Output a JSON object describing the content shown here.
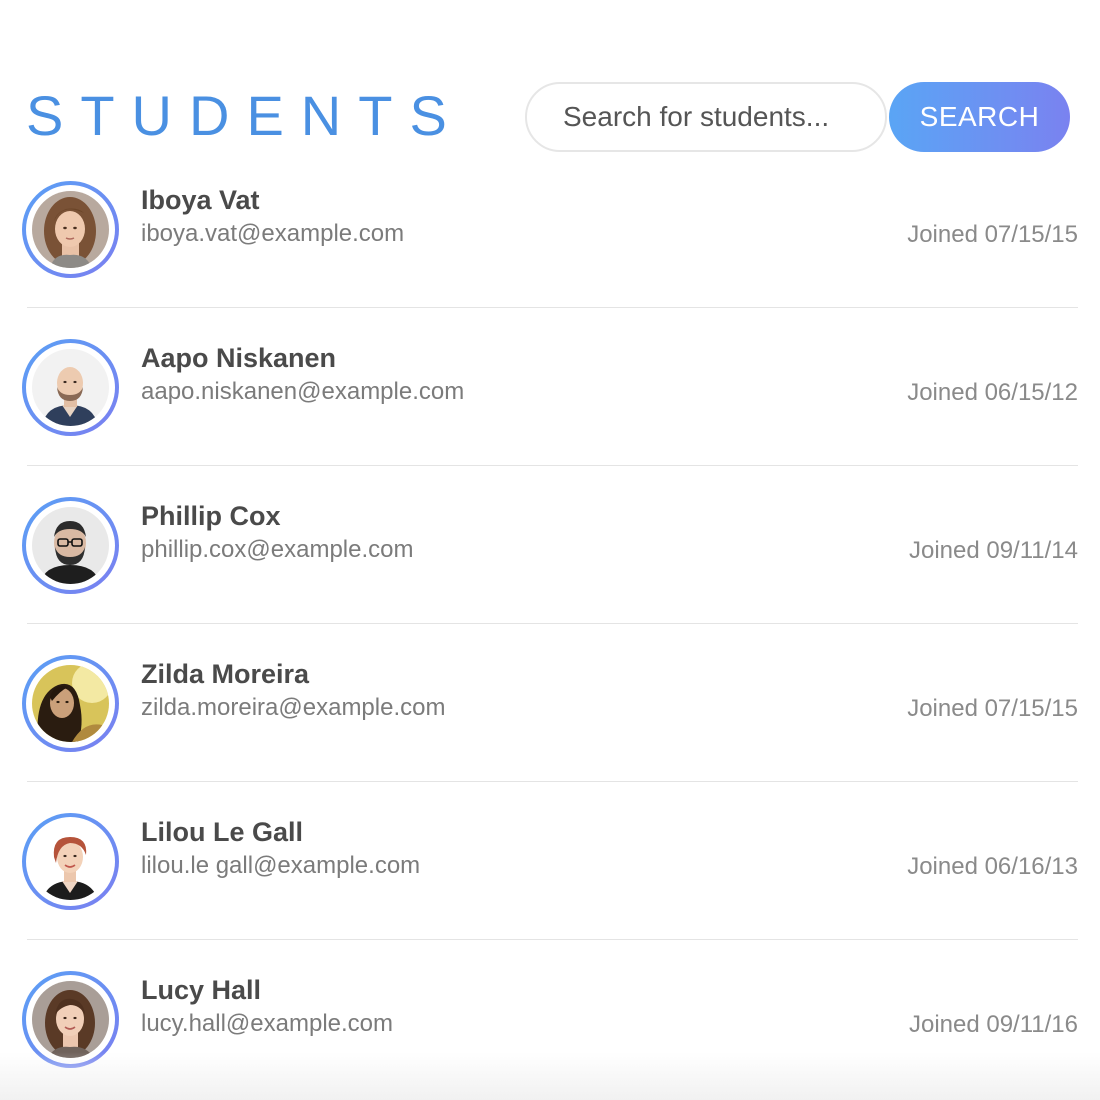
{
  "header": {
    "title": "STUDENTS"
  },
  "search": {
    "placeholder": "Search for students...",
    "value": "",
    "button_label": "SEARCH"
  },
  "colors": {
    "title": "#4a90e2",
    "button_gradient_start": "#5aa5f5",
    "button_gradient_end": "#7a82f0",
    "avatar_ring_start": "#5aa0f5",
    "avatar_ring_end": "#7b7ff0"
  },
  "students": [
    {
      "name": "Iboya Vat",
      "email": "iboya.vat@example.com",
      "joined": "Joined 07/15/15"
    },
    {
      "name": "Aapo Niskanen",
      "email": "aapo.niskanen@example.com",
      "joined": "Joined 06/15/12"
    },
    {
      "name": "Phillip Cox",
      "email": "phillip.cox@example.com",
      "joined": "Joined 09/11/14"
    },
    {
      "name": "Zilda Moreira",
      "email": "zilda.moreira@example.com",
      "joined": "Joined 07/15/15"
    },
    {
      "name": "Lilou Le Gall",
      "email": "lilou.le gall@example.com",
      "joined": "Joined 06/16/13"
    },
    {
      "name": "Lucy Hall",
      "email": "lucy.hall@example.com",
      "joined": "Joined 09/11/16"
    }
  ]
}
